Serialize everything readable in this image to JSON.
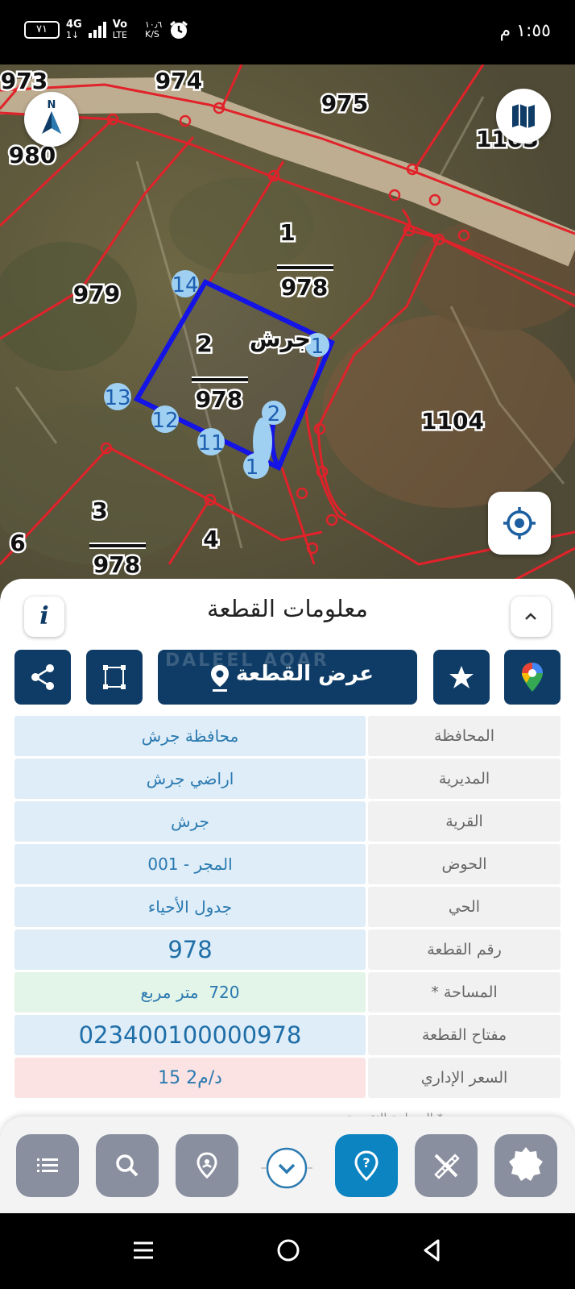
{
  "status_bar": {
    "battery": "٧١",
    "network_type": "4G",
    "network_sub": "1↓",
    "operator": "Vo",
    "operator_sub": "LTE",
    "speed_value": "١٠٫٦",
    "speed_unit": "K/S",
    "time": "١:٥٥ م"
  },
  "map": {
    "parcel_labels": [
      "973",
      "974",
      "975",
      "980",
      "1103",
      "979",
      "1104",
      "6"
    ],
    "fraction_top": [
      "1",
      "2",
      "3"
    ],
    "fraction_bottom": "978",
    "small_number": "4",
    "place_label": "جرش",
    "vertex_labels": [
      "14",
      "1",
      "13",
      "12",
      "11",
      "2",
      "1"
    ]
  },
  "panel": {
    "title": "معلومات القطعة",
    "show_parcel_label": "عرض القطعة",
    "watermark": "DALEEL AQAR",
    "rows": [
      {
        "label": "المحافظة",
        "value": "محافظة جرش"
      },
      {
        "label": "المديرية",
        "value": "اراضي جرش"
      },
      {
        "label": "القرية",
        "value": "جرش"
      },
      {
        "label": "الحوض",
        "value": "المجر - 001"
      },
      {
        "label": "الحي",
        "value": "جدول الأحياء"
      },
      {
        "label": "رقم القطعة",
        "value": "978"
      },
      {
        "label": "المساحة *",
        "value": "720  متر مربع"
      },
      {
        "label": "مفتاح القطعة",
        "value": "023400100000978"
      },
      {
        "label": "السعر الإداري",
        "value": "15 د/م2"
      }
    ],
    "note": "* المساحة التقريبية"
  },
  "colors": {
    "brand_navy": "#0f3c66",
    "active_blue": "#0d84c2",
    "boundary_red": "#e1222a",
    "selected_parcel": "#1414e6"
  },
  "icons": {
    "toolbar": [
      "list-icon",
      "search-icon",
      "place-pin-icon",
      "chevron-down-icon",
      "help-pin-icon",
      "measure-tools-icon",
      "star-badge-icon"
    ]
  }
}
